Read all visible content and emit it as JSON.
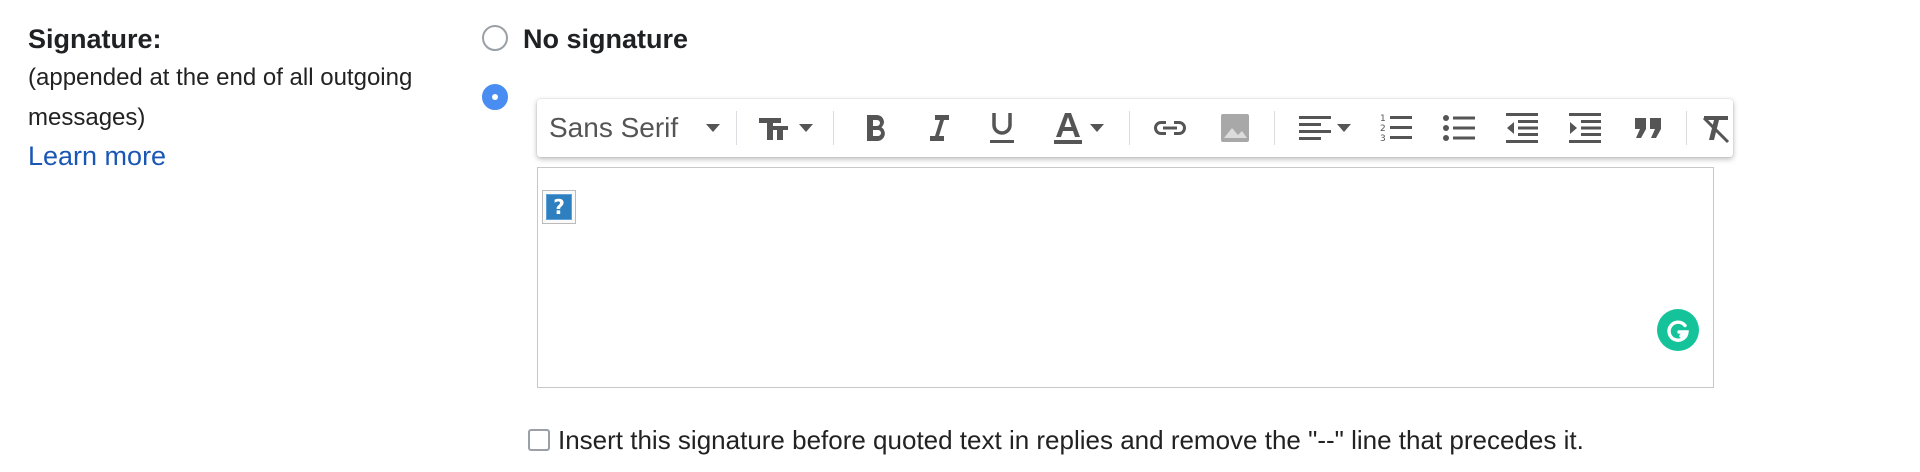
{
  "label": {
    "title": "Signature:",
    "subtitle_line1": "(appended at the end of all outgoing",
    "subtitle_line2": "messages)",
    "learn_more": "Learn more"
  },
  "options": {
    "no_signature": "No signature",
    "selected": "custom"
  },
  "toolbar": {
    "font_family": "Sans Serif",
    "buttons": [
      "font-size",
      "bold",
      "italic",
      "underline",
      "text-color",
      "link",
      "image",
      "align",
      "numbered-list",
      "bulleted-list",
      "indent-less",
      "indent-more",
      "quote",
      "remove-formatting"
    ],
    "icon_color": "#555555"
  },
  "editor": {
    "broken_image_glyph": "?",
    "grammarly_color": "#15c39a"
  },
  "insert_before_quoted": {
    "label": "Insert this signature before quoted text in replies and remove the \"--\" line that precedes it.",
    "checked": false
  },
  "colors": {
    "link": "#1a57b4",
    "radio_selected": "#4a8df2"
  }
}
